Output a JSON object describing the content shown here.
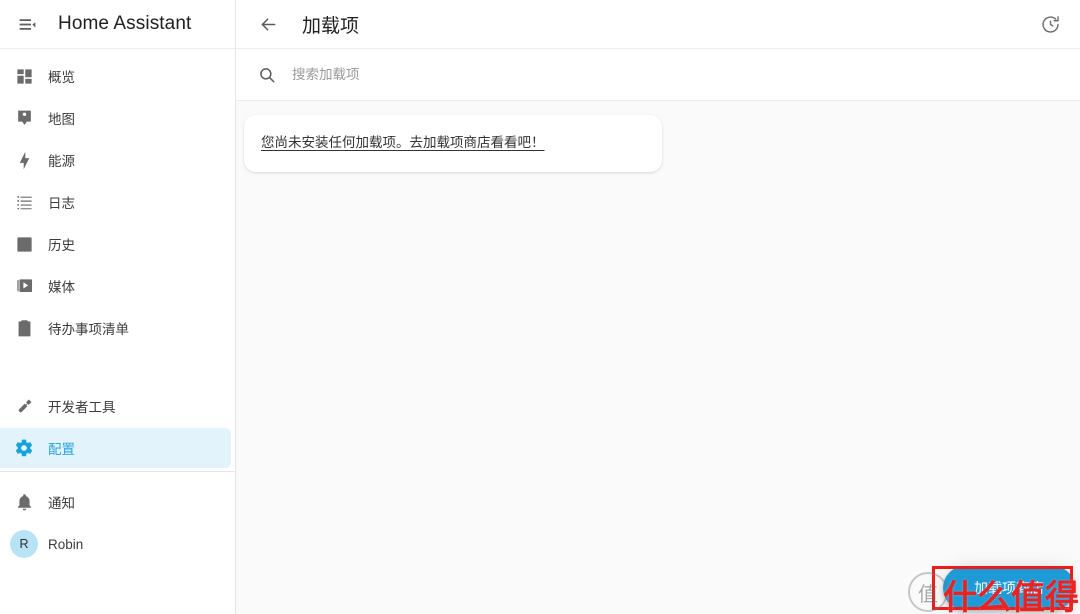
{
  "sidebar": {
    "title": "Home Assistant",
    "menu_icon": "menu-open-icon",
    "items": [
      {
        "label": "概览",
        "icon": "view-dashboard-icon",
        "active": false
      },
      {
        "label": "地图",
        "icon": "map-marker-account-icon",
        "active": false
      },
      {
        "label": "能源",
        "icon": "lightning-bolt-icon",
        "active": false
      },
      {
        "label": "日志",
        "icon": "format-list-bulleted-icon",
        "active": false
      },
      {
        "label": "历史",
        "icon": "chart-box-icon",
        "active": false
      },
      {
        "label": "媒体",
        "icon": "play-box-multiple-icon",
        "active": false
      },
      {
        "label": "待办事项清单",
        "icon": "clipboard-list-icon",
        "active": false
      }
    ],
    "tools": [
      {
        "label": "开发者工具",
        "icon": "hammer-icon",
        "active": false
      },
      {
        "label": "配置",
        "icon": "cog-icon",
        "active": true
      }
    ],
    "bottom": [
      {
        "label": "通知",
        "icon": "bell-icon"
      }
    ],
    "user": {
      "label": "Robin",
      "initial": "R"
    }
  },
  "toolbar": {
    "back_icon": "arrow-left-icon",
    "title": "加载项",
    "refresh_icon": "reload-clock-icon"
  },
  "search": {
    "icon": "search-icon",
    "placeholder": "搜索加载项",
    "value": ""
  },
  "content": {
    "empty_message": "您尚未安装任何加载项。去加载项商店看看吧！"
  },
  "fab": {
    "label": "加载项商店"
  },
  "watermark": {
    "badge": "值",
    "text": "什么值得买"
  },
  "colors": {
    "accent": "#1e9ad6",
    "active_bg": "#e3f3fb",
    "active_text": "#29a4dd",
    "annotation": "#ee1b1b",
    "page_bg": "#fafafa",
    "surface": "#ffffff",
    "avatar_bg": "#b8e3f5"
  }
}
